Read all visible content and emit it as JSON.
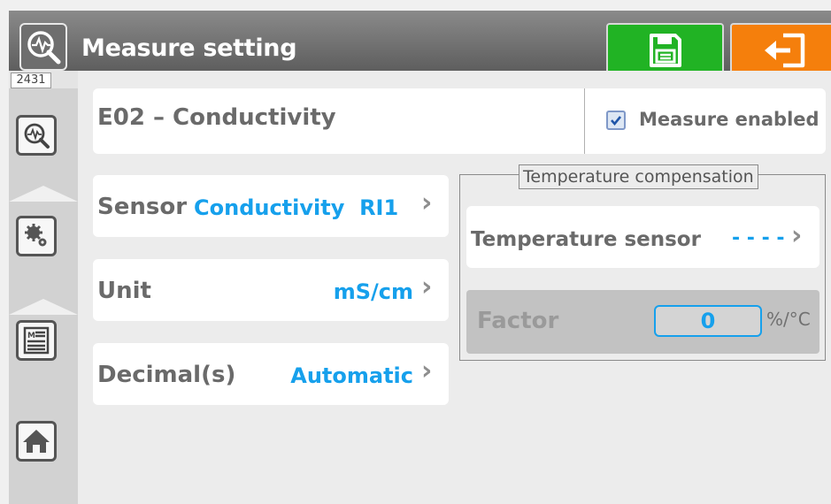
{
  "header": {
    "title": "Measure setting",
    "title_icon": "measure-magnifier-icon",
    "save_icon": "floppy-disk-icon",
    "exit_icon": "exit-arrow-icon"
  },
  "sidebar": {
    "counter": "2431",
    "tabs": [
      {
        "icon": "measure-magnifier-icon"
      },
      {
        "icon": "gears-icon"
      },
      {
        "icon": "document-list-icon"
      },
      {
        "icon": "home-icon"
      }
    ]
  },
  "measure": {
    "name": "E02 – Conductivity",
    "enabled_label": "Measure enabled",
    "enabled": true
  },
  "sensor": {
    "label": "Sensor",
    "value": "Conductivity  RI1"
  },
  "unit": {
    "label": "Unit",
    "value": "mS/cm"
  },
  "decimals": {
    "label": "Decimal(s)",
    "value": "Automatic"
  },
  "temp_comp": {
    "legend": "Temperature compensation",
    "sensor_label": "Temperature sensor",
    "sensor_value": "- - - -",
    "factor_label": "Factor",
    "factor_value": "0",
    "factor_unit": "%/°C"
  },
  "chevron": "›",
  "colors": {
    "accent": "#16a0ec",
    "save": "#21b324",
    "exit": "#f57f0c",
    "title_bar": "#6e6e6e"
  }
}
